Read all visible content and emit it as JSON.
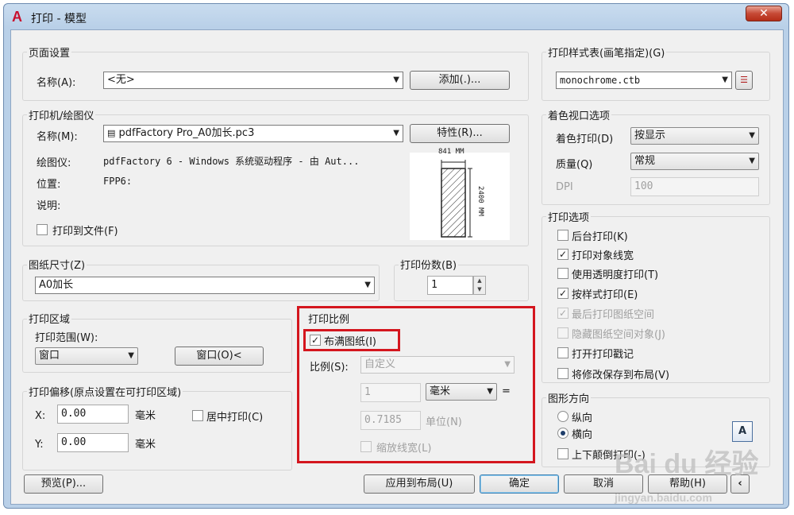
{
  "window": {
    "title": "打印 - 模型",
    "close_label": "✕",
    "app_icon": "autocad-icon"
  },
  "page_setup": {
    "title": "页面设置",
    "name_label": "名称(A):",
    "name_value": "<无>",
    "add_button": "添加(.)..."
  },
  "printer": {
    "title": "打印机/绘图仪",
    "name_label": "名称(M):",
    "name_value": "pdfFactory Pro_A0加长.pc3",
    "properties_button": "特性(R)...",
    "plotter_label": "绘图仪:",
    "plotter_value": "pdfFactory 6 - Windows 系统驱动程序 - 由 Aut...",
    "location_label": "位置:",
    "location_value": "FPP6:",
    "description_label": "说明:",
    "print_to_file_label": "打印到文件(F)",
    "print_to_file_checked": false,
    "preview_width_label": "841 MM",
    "preview_height_label": "2400 MM"
  },
  "paper_size": {
    "title": "图纸尺寸(Z)",
    "value": "A0加长"
  },
  "copies": {
    "title": "打印份数(B)",
    "value": "1"
  },
  "plot_area": {
    "title": "打印区域",
    "range_label": "打印范围(W):",
    "range_value": "窗口",
    "window_button": "窗口(O)<"
  },
  "plot_offset": {
    "title": "打印偏移(原点设置在可打印区域)",
    "x_label": "X:",
    "x_value": "0.00",
    "x_unit": "毫米",
    "y_label": "Y:",
    "y_value": "0.00",
    "y_unit": "毫米",
    "center_label": "居中打印(C)",
    "center_checked": false
  },
  "plot_scale": {
    "title": "打印比例",
    "fit_label": "布满图纸(I)",
    "fit_checked": true,
    "scale_label": "比例(S):",
    "scale_value": "自定义",
    "value1": "1",
    "unit_value": "毫米",
    "equals": "=",
    "value2": "0.7185",
    "unit2_label": "单位(N)",
    "lineweights_label": "缩放线宽(L)",
    "lineweights_checked": false
  },
  "plot_style": {
    "title": "打印样式表(画笔指定)(G)",
    "value": "monochrome.ctb",
    "edit_icon": "edit-pen-table-icon"
  },
  "shaded_viewport": {
    "title": "着色视口选项",
    "shade_label": "着色打印(D)",
    "shade_value": "按显示",
    "quality_label": "质量(Q)",
    "quality_value": "常规",
    "dpi_label": "DPI",
    "dpi_value": "100"
  },
  "plot_options": {
    "title": "打印选项",
    "items": [
      {
        "label": "后台打印(K)",
        "checked": false,
        "disabled": false
      },
      {
        "label": "打印对象线宽",
        "checked": true,
        "disabled": false
      },
      {
        "label": "使用透明度打印(T)",
        "checked": false,
        "disabled": false
      },
      {
        "label": "按样式打印(E)",
        "checked": true,
        "disabled": false
      },
      {
        "label": "最后打印图纸空间",
        "checked": true,
        "disabled": true
      },
      {
        "label": "隐藏图纸空间对象(J)",
        "checked": false,
        "disabled": true
      },
      {
        "label": "打开打印戳记",
        "checked": false,
        "disabled": false
      },
      {
        "label": "将修改保存到布局(V)",
        "checked": false,
        "disabled": false
      }
    ]
  },
  "orientation": {
    "title": "图形方向",
    "portrait_label": "纵向",
    "landscape_label": "横向",
    "selected": "横向",
    "upside_down_label": "上下颠倒打印(-)",
    "upside_down_checked": false,
    "orientation_icon": "landscape-a-icon",
    "orientation_icon_letter": "A"
  },
  "footer": {
    "preview_button": "预览(P)...",
    "apply_button": "应用到布局(U)",
    "ok_button": "确定",
    "cancel_button": "取消",
    "help_button": "帮助(H)",
    "collapse_icon": "‹"
  },
  "watermark": {
    "main": "Bai du 经验",
    "sub": "jingyan.baidu.com"
  }
}
